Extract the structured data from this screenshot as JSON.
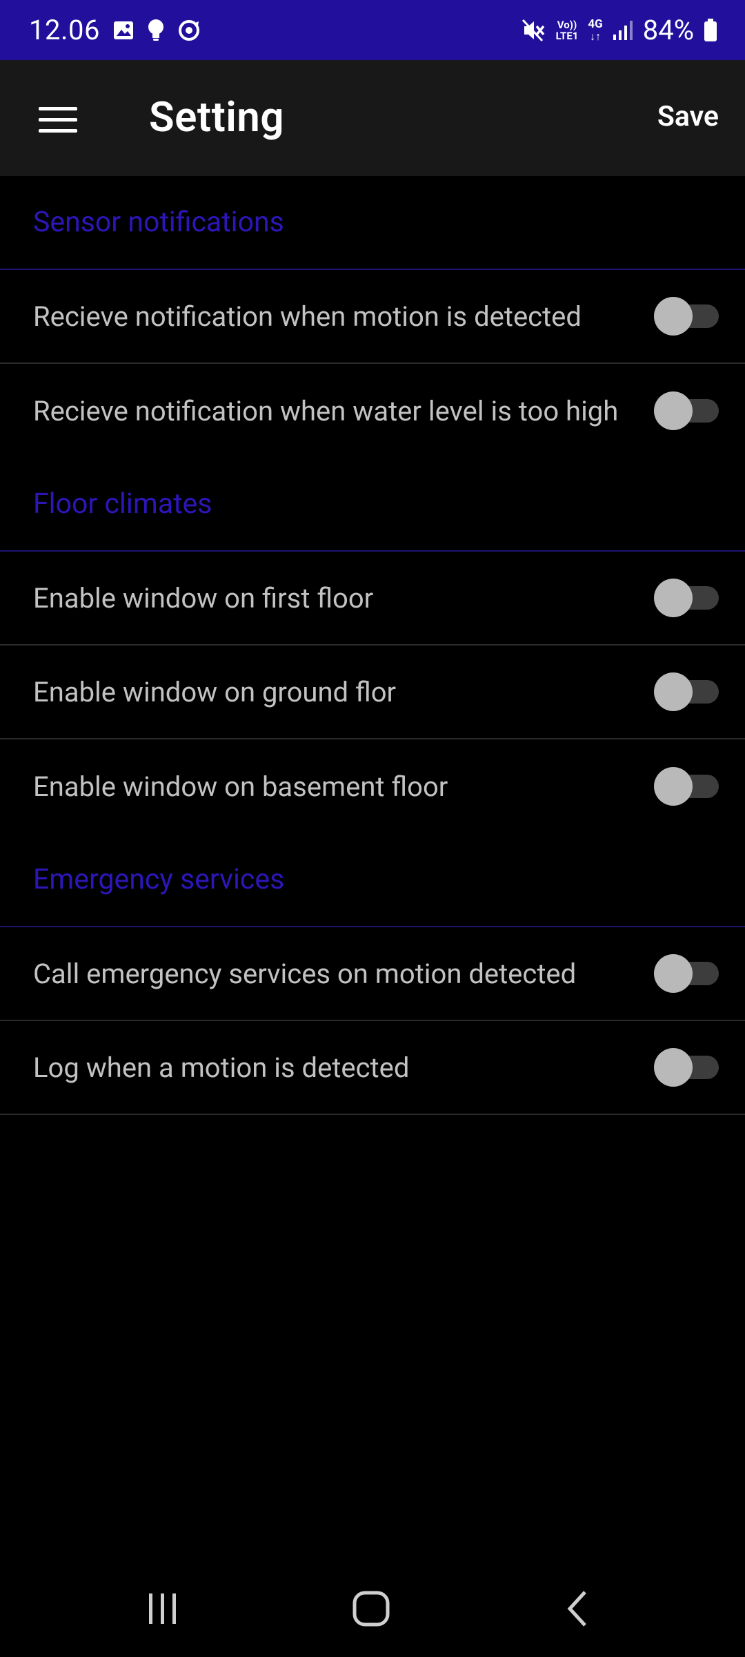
{
  "status_bar": {
    "time": "12.06",
    "battery": "84%",
    "left_icons": [
      "gallery-icon",
      "bulb-icon",
      "sync-icon"
    ],
    "right_icons": [
      "mute-icon",
      "volte-icon",
      "4g-icon",
      "signal-icon",
      "battery-icon"
    ],
    "volte_label_top": "Vo))",
    "volte_label_bottom": "LTE1",
    "network_label": "4G",
    "background_color": "#22109c"
  },
  "app_bar": {
    "title": "Setting",
    "save_label": "Save",
    "menu_icon": "hamburger-menu-icon"
  },
  "colors": {
    "section_header": "#2c16b8",
    "row_text": "#c2c2c2",
    "background": "#000000",
    "app_bar": "#181818"
  },
  "sections": [
    {
      "title": "Sensor notifications",
      "items": [
        {
          "label": "Recieve notification when motion is detected",
          "enabled": false
        },
        {
          "label": "Recieve notification when water level is too high",
          "enabled": false
        }
      ]
    },
    {
      "title": "Floor climates",
      "items": [
        {
          "label": "Enable window on first floor",
          "enabled": false
        },
        {
          "label": "Enable window on ground flor",
          "enabled": false
        },
        {
          "label": "Enable window on basement floor",
          "enabled": false
        }
      ]
    },
    {
      "title": "Emergency services",
      "items": [
        {
          "label": "Call emergency services on motion detected",
          "enabled": false
        },
        {
          "label": "Log when a motion is detected",
          "enabled": false
        }
      ]
    }
  ],
  "nav_bar": {
    "buttons": [
      "recents-icon",
      "home-icon",
      "back-icon"
    ]
  }
}
